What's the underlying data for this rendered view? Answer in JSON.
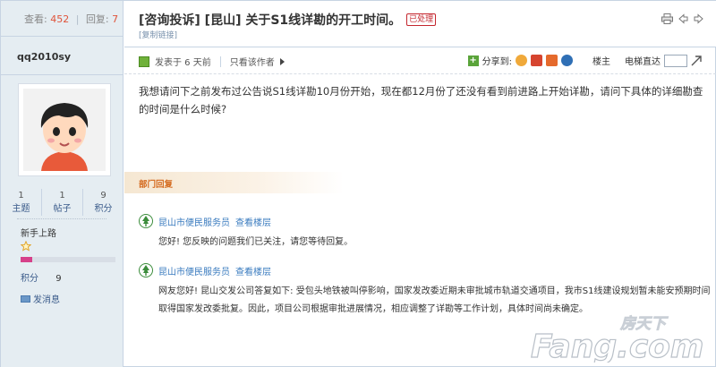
{
  "sidebar": {
    "views_label": "查看:",
    "views": "452",
    "replies_label": "回复:",
    "replies": "7",
    "username": "qq2010sy",
    "counts": [
      {
        "value": "1",
        "label": "主题"
      },
      {
        "value": "1",
        "label": "帖子"
      },
      {
        "value": "9",
        "label": "积分"
      }
    ],
    "rank": "新手上路",
    "rank_progress": 0.12,
    "points_label": "积分",
    "points_value": "9",
    "message_label": "发消息"
  },
  "header": {
    "title": "[咨询投诉] [昆山] 关于S1线详勘的开工时间。",
    "status_badge": "已处理",
    "copy_link": "[复制链接]"
  },
  "postbar": {
    "posted": "发表于 6 天前",
    "only_author": "只看该作者",
    "share_label": "分享到:",
    "floor_label": "楼主",
    "elevator_label": "电梯直达"
  },
  "post": {
    "content": "我想请问下之前发布过公告说S1线详勘10月份开始，现在都12月份了还没有看到前进路上开始详勘，请问下具体的详细勘查的时间是什么时候?"
  },
  "dept_reply_label": "部门回复",
  "replies": [
    {
      "author": "昆山市便民服务员",
      "floor_link": "查看楼层",
      "text": "您好! 您反映的问题我们已关注，请您等待回复。"
    },
    {
      "author": "昆山市便民服务员",
      "floor_link": "查看楼层",
      "text": "网友您好! 昆山交发公司答复如下: 受包头地铁被叫停影响，国家发改委近期未审批城市轨道交通项目，我市S1线建设规划暂未能安预期时间取得国家发改委批复。因此，项目公司根据审批进展情况，相应调整了详勘等工作计划，具体时间尚未确定。"
    }
  ],
  "watermark": {
    "brand": "Fang.com",
    "cn": "房天下"
  },
  "colors": {
    "sidebar_bg": "#e5edf2",
    "border": "#c7d4e3",
    "link": "#3a7bbf",
    "accent_red": "#c4262e",
    "dept_orange": "#d46a1e"
  }
}
